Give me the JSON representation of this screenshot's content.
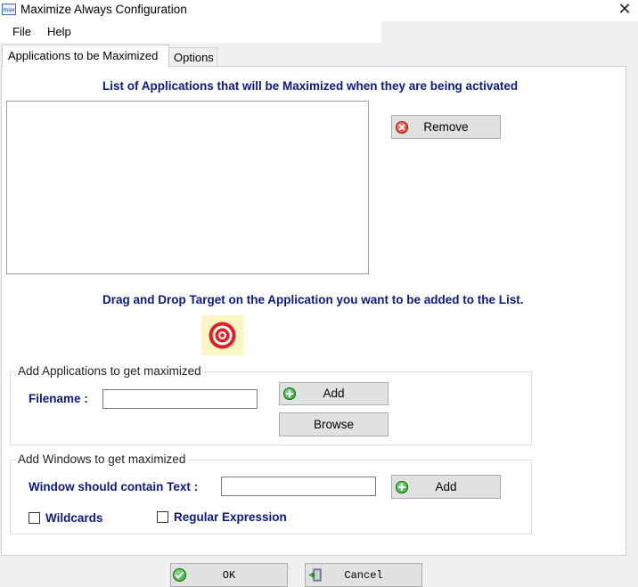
{
  "window": {
    "title": "Maximize Always Configuration",
    "icon_text": "max",
    "close_glyph": "✕"
  },
  "menu": [
    {
      "label": "File"
    },
    {
      "label": "Help"
    }
  ],
  "tabs": [
    {
      "label": "Applications to be Maximized",
      "active": true
    },
    {
      "label": "Options",
      "active": false
    }
  ],
  "apps_tab": {
    "list_heading": "List of Applications that will be Maximized when they are being activated",
    "applications": [],
    "remove_label": "Remove",
    "drag_heading": "Drag and Drop Target on the Application you want to be added to the List.",
    "add_apps_group": {
      "title": "Add Applications to get maximized",
      "filename_label": "Filename :",
      "filename_value": "",
      "add_label": "Add",
      "browse_label": "Browse"
    },
    "add_windows_group": {
      "title": "Add Windows to get maximized",
      "text_label": "Window should contain Text :",
      "text_value": "",
      "add_label": "Add",
      "wildcards_label": "Wildcards",
      "wildcards_checked": false,
      "regex_label": "Regular Expression",
      "regex_checked": false
    }
  },
  "footer": {
    "ok_label": "OK",
    "cancel_label": "Cancel"
  },
  "colors": {
    "label_blue": "#0a1a80",
    "target_bg": "#fbf6c4",
    "target_red": "#e02020"
  },
  "icons": {
    "remove": "red-x-circle-icon",
    "add": "green-plus-circle-icon",
    "target": "bullseye-target-icon",
    "ok": "green-check-circle-icon",
    "cancel": "exit-door-icon"
  }
}
